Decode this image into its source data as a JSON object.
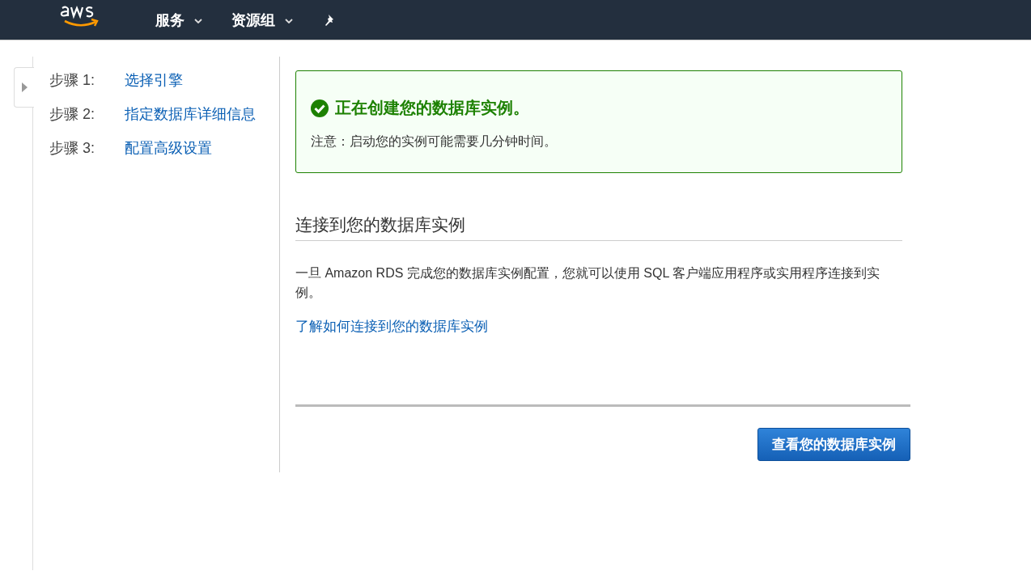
{
  "nav": {
    "menus": [
      {
        "label": "服务"
      },
      {
        "label": "资源组"
      }
    ]
  },
  "steps": [
    {
      "number": "步骤 1:",
      "label": "选择引擎"
    },
    {
      "number": "步骤 2:",
      "label": "指定数据库详细信息"
    },
    {
      "number": "步骤 3:",
      "label": "配置高级设置"
    }
  ],
  "alert": {
    "title": "正在创建您的数据库实例。",
    "note": "注意：启动您的实例可能需要几分钟时间。"
  },
  "connect": {
    "heading": "连接到您的数据库实例",
    "text": "一旦 Amazon RDS 完成您的数据库实例配置，您就可以使用 SQL 客户端应用程序或实用程序连接到实例。",
    "link": "了解如何连接到您的数据库实例"
  },
  "button": "查看您的数据库实例"
}
